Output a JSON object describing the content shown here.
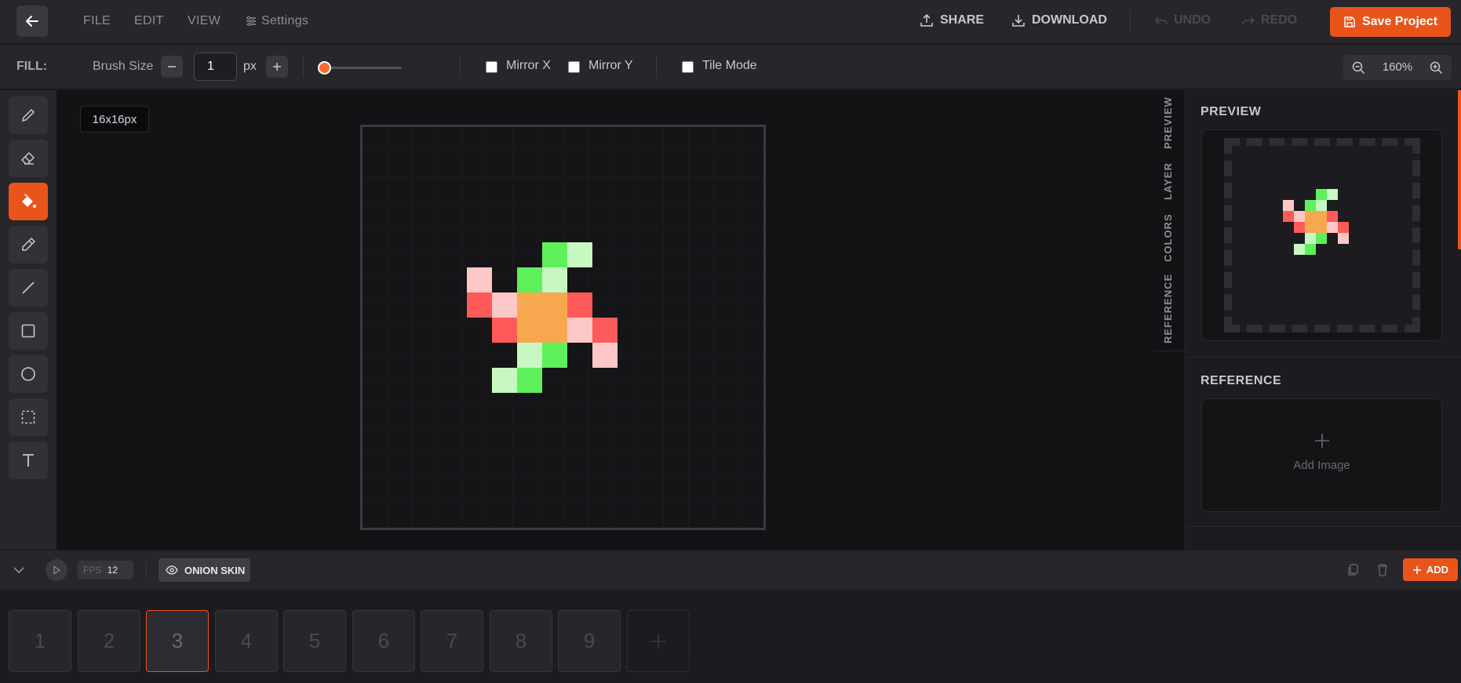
{
  "topbar": {
    "menus": [
      "FILE",
      "EDIT",
      "VIEW"
    ],
    "settings_label": "Settings",
    "share_label": "SHARE",
    "download_label": "DOWNLOAD",
    "undo_label": "UNDO",
    "redo_label": "REDO",
    "save_label": "Save Project"
  },
  "toolbar": {
    "fill_label": "FILL:",
    "brush_size_label": "Brush Size",
    "brush_size_value": "1",
    "brush_unit": "px",
    "mirror_x_label": "Mirror X",
    "mirror_y_label": "Mirror Y",
    "tile_mode_label": "Tile Mode",
    "zoom": "160%"
  },
  "tools": [
    {
      "name": "pencil-icon",
      "active": false
    },
    {
      "name": "eraser-icon",
      "active": false
    },
    {
      "name": "fill-bucket-icon",
      "active": true
    },
    {
      "name": "eyedropper-icon",
      "active": false
    },
    {
      "name": "line-icon",
      "active": false
    },
    {
      "name": "rectangle-icon",
      "active": false
    },
    {
      "name": "circle-icon",
      "active": false
    },
    {
      "name": "selection-icon",
      "active": false
    },
    {
      "name": "text-icon",
      "active": false
    }
  ],
  "canvas": {
    "size_label": "16x16px",
    "pixels": [
      {
        "col": 7,
        "row": 5,
        "color": "#5ef05a"
      },
      {
        "col": 8,
        "row": 5,
        "color": "#c8f8c2"
      },
      {
        "col": 4,
        "row": 6,
        "color": "#ffc8c8"
      },
      {
        "col": 6,
        "row": 6,
        "color": "#5ef05a"
      },
      {
        "col": 7,
        "row": 6,
        "color": "#c8f8c2"
      },
      {
        "col": 4,
        "row": 7,
        "color": "#ff5a5a"
      },
      {
        "col": 5,
        "row": 7,
        "color": "#ffc8c8"
      },
      {
        "col": 6,
        "row": 7,
        "color": "#f7a84e"
      },
      {
        "col": 7,
        "row": 7,
        "color": "#f7a84e"
      },
      {
        "col": 8,
        "row": 7,
        "color": "#ff5a5a"
      },
      {
        "col": 5,
        "row": 8,
        "color": "#ff5a5a"
      },
      {
        "col": 6,
        "row": 8,
        "color": "#f7a84e"
      },
      {
        "col": 7,
        "row": 8,
        "color": "#f7a84e"
      },
      {
        "col": 8,
        "row": 8,
        "color": "#ffc8c8"
      },
      {
        "col": 9,
        "row": 8,
        "color": "#ff5a5a"
      },
      {
        "col": 6,
        "row": 9,
        "color": "#c8f8c2"
      },
      {
        "col": 7,
        "row": 9,
        "color": "#5ef05a"
      },
      {
        "col": 9,
        "row": 9,
        "color": "#ffc8c8"
      },
      {
        "col": 5,
        "row": 10,
        "color": "#c8f8c2"
      },
      {
        "col": 6,
        "row": 10,
        "color": "#5ef05a"
      }
    ]
  },
  "side_tabs": [
    "PREVIEW",
    "LAYER",
    "COLORS",
    "REFERENCE"
  ],
  "panel": {
    "preview_title": "PREVIEW",
    "reference_title": "REFERENCE",
    "add_image_label": "Add Image"
  },
  "timeline": {
    "fps_label": "FPS",
    "fps_value": "12",
    "onion_label": "ONION SKIN",
    "add_label": "ADD",
    "frames": [
      "1",
      "2",
      "3",
      "4",
      "5",
      "6",
      "7",
      "8",
      "9"
    ],
    "active_frame": "3"
  },
  "colors": {
    "accent": "#e8541a"
  }
}
